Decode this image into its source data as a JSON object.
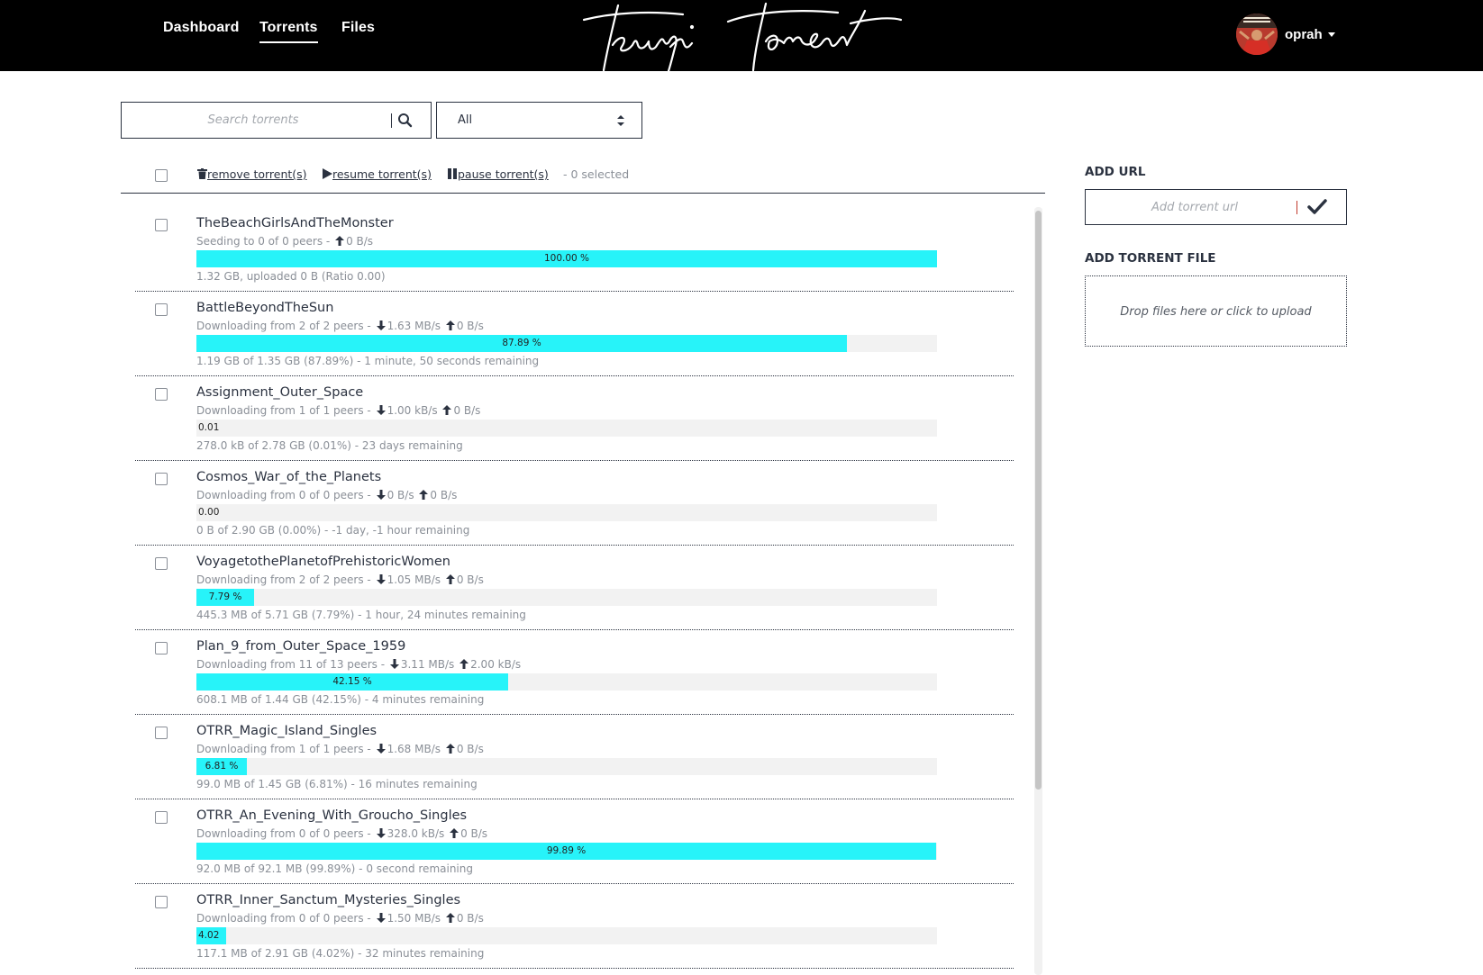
{
  "nav": {
    "items": [
      {
        "label": "Dashboard",
        "active": false
      },
      {
        "label": "Torrents",
        "active": true
      },
      {
        "label": "Files",
        "active": false
      }
    ]
  },
  "brand": {
    "logo_text": "Teurpi Torrent"
  },
  "user": {
    "name": "oprah",
    "icon": "avatar-image"
  },
  "search": {
    "placeholder": "Search torrents",
    "value": "",
    "icon": "search-icon"
  },
  "filter": {
    "value": "All"
  },
  "toolbar": {
    "remove_label": "remove torrent(s)",
    "resume_label": "resume torrent(s)",
    "pause_label": "pause torrent(s)",
    "selected_text": "- 0 selected"
  },
  "torrents": [
    {
      "name": "TheBeachGirlsAndTheMonster",
      "status_prefix": "Seeding to 0 of 0 peers -",
      "down": "",
      "up": "0 B/s",
      "progress": 100.0,
      "progress_label": "100.00 %",
      "summary": "1.32 GB, uploaded 0 B (Ratio 0.00)"
    },
    {
      "name": "BattleBeyondTheSun",
      "status_prefix": "Downloading from 2 of 2 peers -",
      "down": "1.63 MB/s",
      "up": "0 B/s",
      "progress": 87.89,
      "progress_label": "87.89 %",
      "summary": "1.19 GB of 1.35 GB (87.89%) - 1 minute, 50 seconds remaining"
    },
    {
      "name": "Assignment_Outer_Space",
      "status_prefix": "Downloading from 1 of 1 peers -",
      "down": "1.00 kB/s",
      "up": "0 B/s",
      "progress": 0.01,
      "progress_label": "0.01",
      "summary": "278.0 kB of 2.78 GB (0.01%) - 23 days remaining"
    },
    {
      "name": "Cosmos_War_of_the_Planets",
      "status_prefix": "Downloading from 0 of 0 peers -",
      "down": "0 B/s",
      "up": "0 B/s",
      "progress": 0.0,
      "progress_label": "0.00",
      "summary": "0 B of 2.90 GB (0.00%) - -1 day, -1 hour remaining"
    },
    {
      "name": "VoyagetothePlanetofPrehistoricWomen",
      "status_prefix": "Downloading from 2 of 2 peers -",
      "down": "1.05 MB/s",
      "up": "0 B/s",
      "progress": 7.79,
      "progress_label": "7.79 %",
      "summary": "445.3 MB of 5.71 GB (7.79%) - 1 hour, 24 minutes remaining"
    },
    {
      "name": "Plan_9_from_Outer_Space_1959",
      "status_prefix": "Downloading from 11 of 13 peers -",
      "down": "3.11 MB/s",
      "up": "2.00 kB/s",
      "progress": 42.15,
      "progress_label": "42.15 %",
      "summary": "608.1 MB of 1.44 GB (42.15%) - 4 minutes remaining"
    },
    {
      "name": "OTRR_Magic_Island_Singles",
      "status_prefix": "Downloading from 1 of 1 peers -",
      "down": "1.68 MB/s",
      "up": "0 B/s",
      "progress": 6.81,
      "progress_label": "6.81 %",
      "summary": "99.0 MB of 1.45 GB (6.81%) - 16 minutes remaining"
    },
    {
      "name": "OTRR_An_Evening_With_Groucho_Singles",
      "status_prefix": "Downloading from 0 of 0 peers -",
      "down": "328.0 kB/s",
      "up": "0 B/s",
      "progress": 99.89,
      "progress_label": "99.89 %",
      "summary": "92.0 MB of 92.1 MB (99.89%) - 0 second remaining"
    },
    {
      "name": "OTRR_Inner_Sanctum_Mysteries_Singles",
      "status_prefix": "Downloading from 0 of 0 peers -",
      "down": "1.50 MB/s",
      "up": "0 B/s",
      "progress": 4.02,
      "progress_label": "4.02",
      "summary": "117.1 MB of 2.91 GB (4.02%) - 32 minutes remaining"
    }
  ],
  "sidebar": {
    "add_url_title": "ADD URL",
    "add_url_placeholder": "Add torrent url",
    "add_file_title": "ADD TORRENT FILE",
    "drop_text": "Drop files here or click to upload"
  },
  "colors": {
    "accent": "#27f3f9",
    "topbar": "#000000",
    "text": "#2b3240",
    "muted": "#8a8f97"
  }
}
